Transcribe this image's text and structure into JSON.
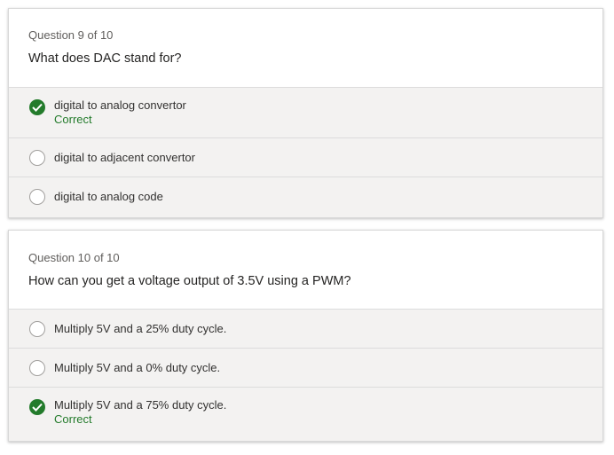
{
  "questions": [
    {
      "number_label": "Question 9 of 10",
      "text": "What does DAC stand for?",
      "options": [
        {
          "label": "digital to analog convertor",
          "selected": true,
          "feedback": "Correct"
        },
        {
          "label": "digital to adjacent convertor",
          "selected": false
        },
        {
          "label": "digital to analog code",
          "selected": false
        }
      ]
    },
    {
      "number_label": "Question 10 of 10",
      "text": "How can you get a voltage output of 3.5V using a PWM?",
      "options": [
        {
          "label": "Multiply 5V and a 25% duty cycle.",
          "selected": false
        },
        {
          "label": "Multiply 5V and a 0% duty cycle.",
          "selected": false
        },
        {
          "label": "Multiply 5V and a 75% duty cycle.",
          "selected": true,
          "feedback": "Correct"
        }
      ]
    }
  ],
  "colors": {
    "correct": "#237b2b",
    "options_bg": "#f3f2f1"
  },
  "icons": {
    "selected": "checkmark-circle-icon",
    "unselected": "radio-circle-icon"
  }
}
